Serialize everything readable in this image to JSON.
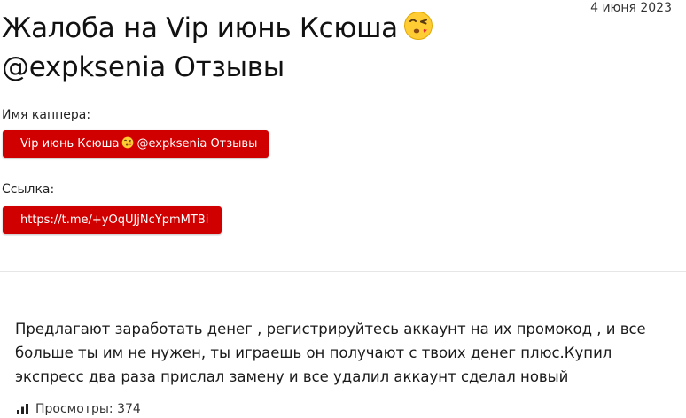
{
  "post": {
    "date": "4 июня 2023",
    "title": "Жалоба на Vip июнь Ксюша",
    "title_line2": "@expksenia Отзывы",
    "title_emoji": "face-blowing-kiss-icon"
  },
  "capper": {
    "label": "Имя каппера:",
    "name_part1": "Vip июнь Ксюша",
    "name_part2": "@expksenia Отзывы"
  },
  "link": {
    "label": "Ссылка:",
    "url": "https://t.me/+yOqUJjNcYpmMTBi"
  },
  "content": {
    "text": "Предлагают заработать денег , регистрируйтесь аккаунт на их промокод , и все больше ты им не нужен, ты играешь он получают с твоих денег плюс.Купил экспресс два раза прислал замену и все удалил аккаунт сделал новый"
  },
  "stats": {
    "views_label": "Просмотры: 374",
    "icon": "bar-chart-icon"
  },
  "colors": {
    "button_red": "#d10000",
    "divider": "#e6e6e6"
  }
}
